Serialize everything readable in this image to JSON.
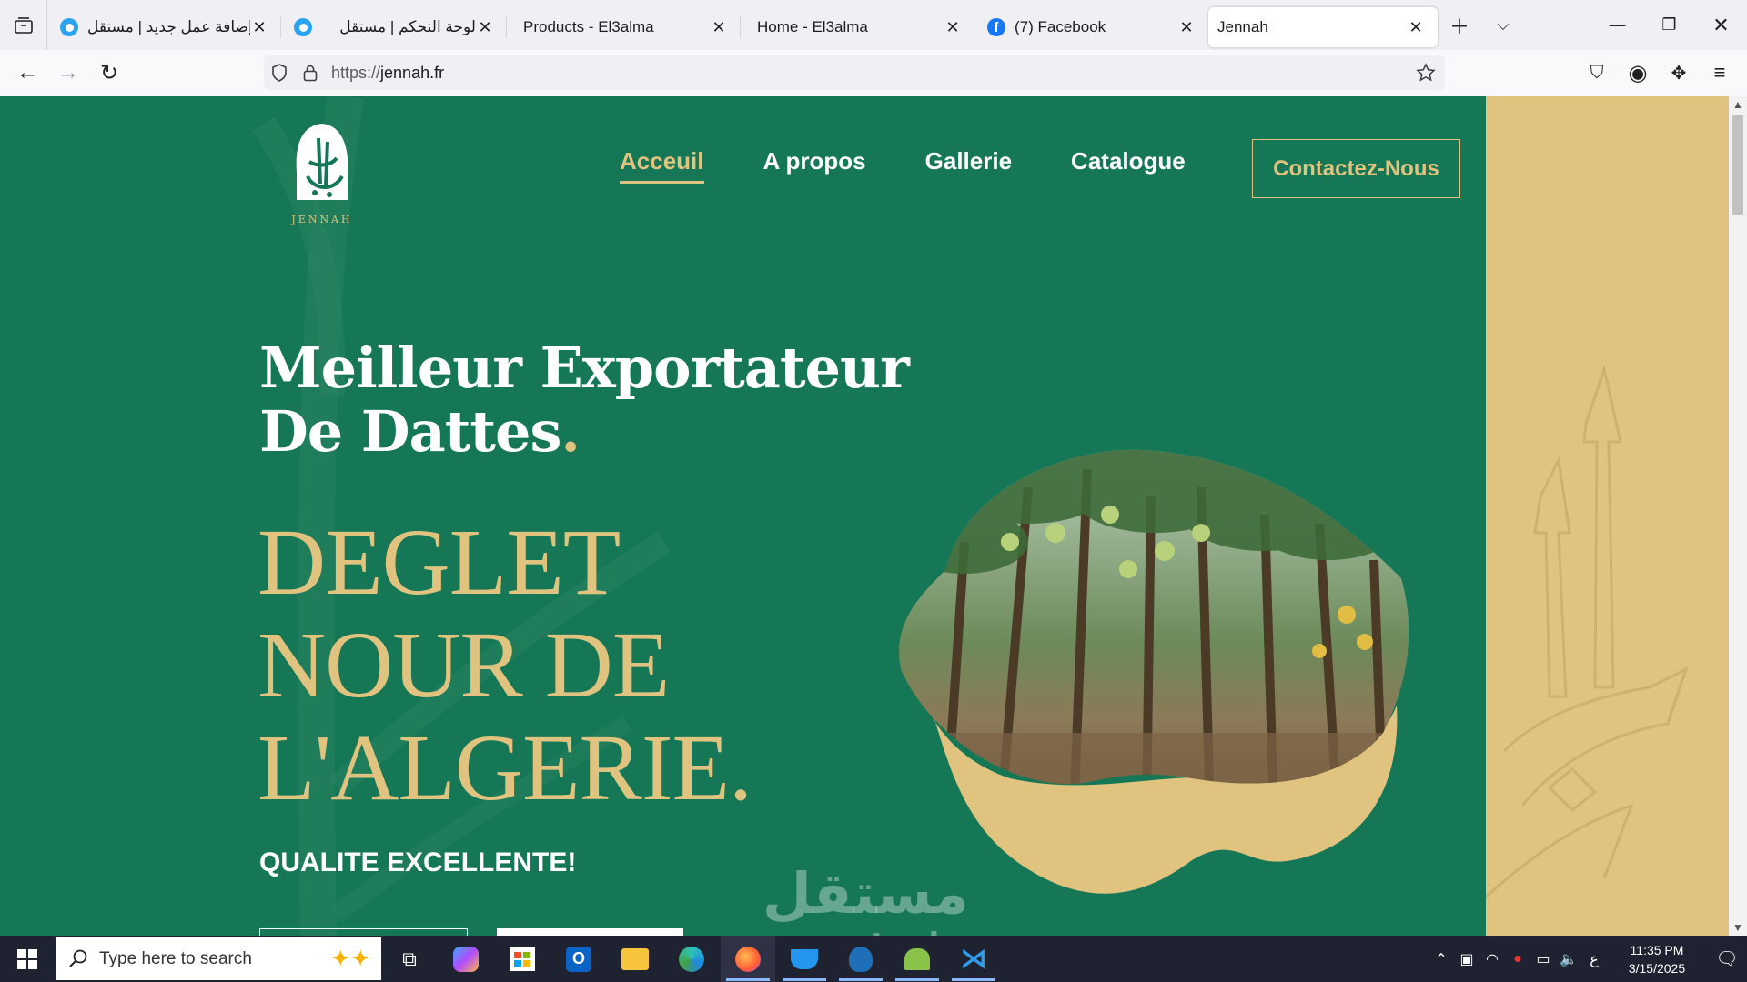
{
  "browser": {
    "tabs": [
      {
        "title": "إضافة عمل جديد | مستقل",
        "favicon": "mostaql-icon",
        "active": false
      },
      {
        "title": "لوحة التحكم | مستقل",
        "favicon": "mostaql-icon",
        "active": false
      },
      {
        "title": "Products - El3alma",
        "favicon": "",
        "active": false
      },
      {
        "title": "Home - El3alma",
        "favicon": "",
        "active": false
      },
      {
        "title": "(7) Facebook",
        "favicon": "facebook-icon",
        "active": false
      },
      {
        "title": "Jennah",
        "favicon": "",
        "active": true
      }
    ],
    "url_protocol": "https://",
    "url_host": "jennah.fr",
    "accent": "#0a84ff"
  },
  "site": {
    "logo_text": "JENNAH",
    "nav": [
      {
        "label": "Acceuil",
        "active": true
      },
      {
        "label": "A propos",
        "active": false
      },
      {
        "label": "Gallerie",
        "active": false
      },
      {
        "label": "Catalogue",
        "active": false
      }
    ],
    "contact_label": "Contactez-Nous",
    "headline_line1": "Meilleur Exportateur",
    "headline_line2": "De Dattes",
    "headline_dot": ".",
    "big_line1": "DEGLET",
    "big_line2": "NOUR DE",
    "big_line3": "L'ALGERIE.",
    "tagline": "QUALITE EXCELLENTE!",
    "colors": {
      "green": "#167756",
      "gold": "#dfc37f"
    }
  },
  "watermark": {
    "arabic": "مستقل",
    "latin": "mostaql.com"
  },
  "taskbar": {
    "search_placeholder": "Type here to search",
    "time": "11:35 PM",
    "date": "3/15/2025",
    "ime": "ع"
  }
}
